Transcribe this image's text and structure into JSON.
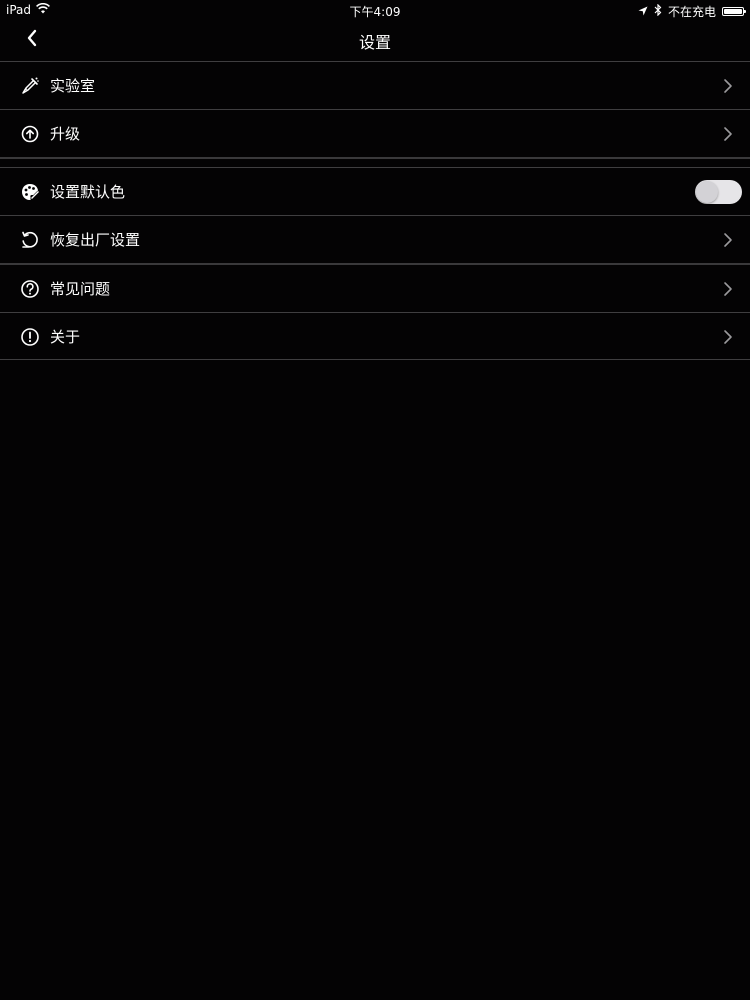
{
  "status_bar": {
    "device": "iPad",
    "time": "下午4:09",
    "charging_status": "不在充电",
    "icons": [
      "wifi-icon",
      "location-icon",
      "bluetooth-icon",
      "battery-icon"
    ],
    "battery_level": 1.0
  },
  "nav": {
    "title": "设置",
    "back_icon": "chevron-left-icon"
  },
  "settings": {
    "items": [
      {
        "label": "实验室",
        "icon": "flask-icon",
        "accessory": "chevron"
      },
      {
        "label": "升级",
        "icon": "arrow-up-circle-icon",
        "accessory": "chevron"
      },
      {
        "label": "设置默认色",
        "icon": "palette-icon",
        "accessory": "toggle",
        "toggle_on": false
      },
      {
        "label": "恢复出厂设置",
        "icon": "reset-icon",
        "accessory": "chevron"
      },
      {
        "label": "常见问题",
        "icon": "question-circle-icon",
        "accessory": "chevron"
      },
      {
        "label": "关于",
        "icon": "info-circle-icon",
        "accessory": "chevron"
      }
    ]
  },
  "colors": {
    "background": "#040304",
    "divider": "#3f3e40",
    "text": "#ffffff",
    "toggle_track": "#e6e5e8"
  }
}
